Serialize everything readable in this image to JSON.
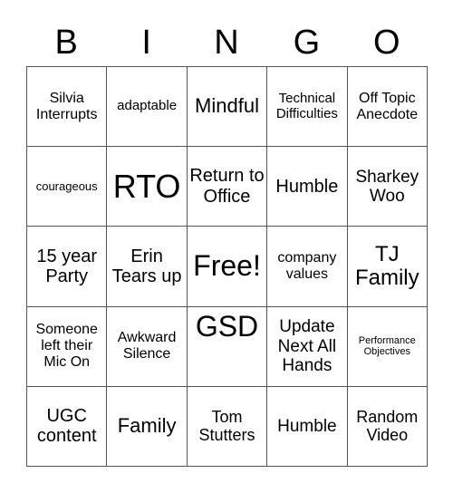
{
  "header": {
    "letters": [
      "B",
      "I",
      "N",
      "G",
      "O"
    ]
  },
  "card": {
    "rows": [
      [
        "Silvia Interrupts",
        "adaptable",
        "Mindful",
        "Technical Difficulties",
        "Off Topic Anecdote"
      ],
      [
        "courageous",
        "RTO",
        "Return to Office",
        "Humble",
        "Sharkey Woo"
      ],
      [
        "15 year Party",
        "Erin Tears up",
        "Free!",
        "company values",
        "TJ Family"
      ],
      [
        "Someone left their Mic On",
        "Awkward Silence",
        "GSD",
        "Update Next All Hands",
        "Performance Objectives"
      ],
      [
        "UGC content",
        "Family",
        "Tom Stutters",
        "Humble",
        "Random Video"
      ]
    ]
  },
  "colors": {
    "grid_line": "#555555",
    "text": "#000000",
    "background": "#ffffff"
  }
}
